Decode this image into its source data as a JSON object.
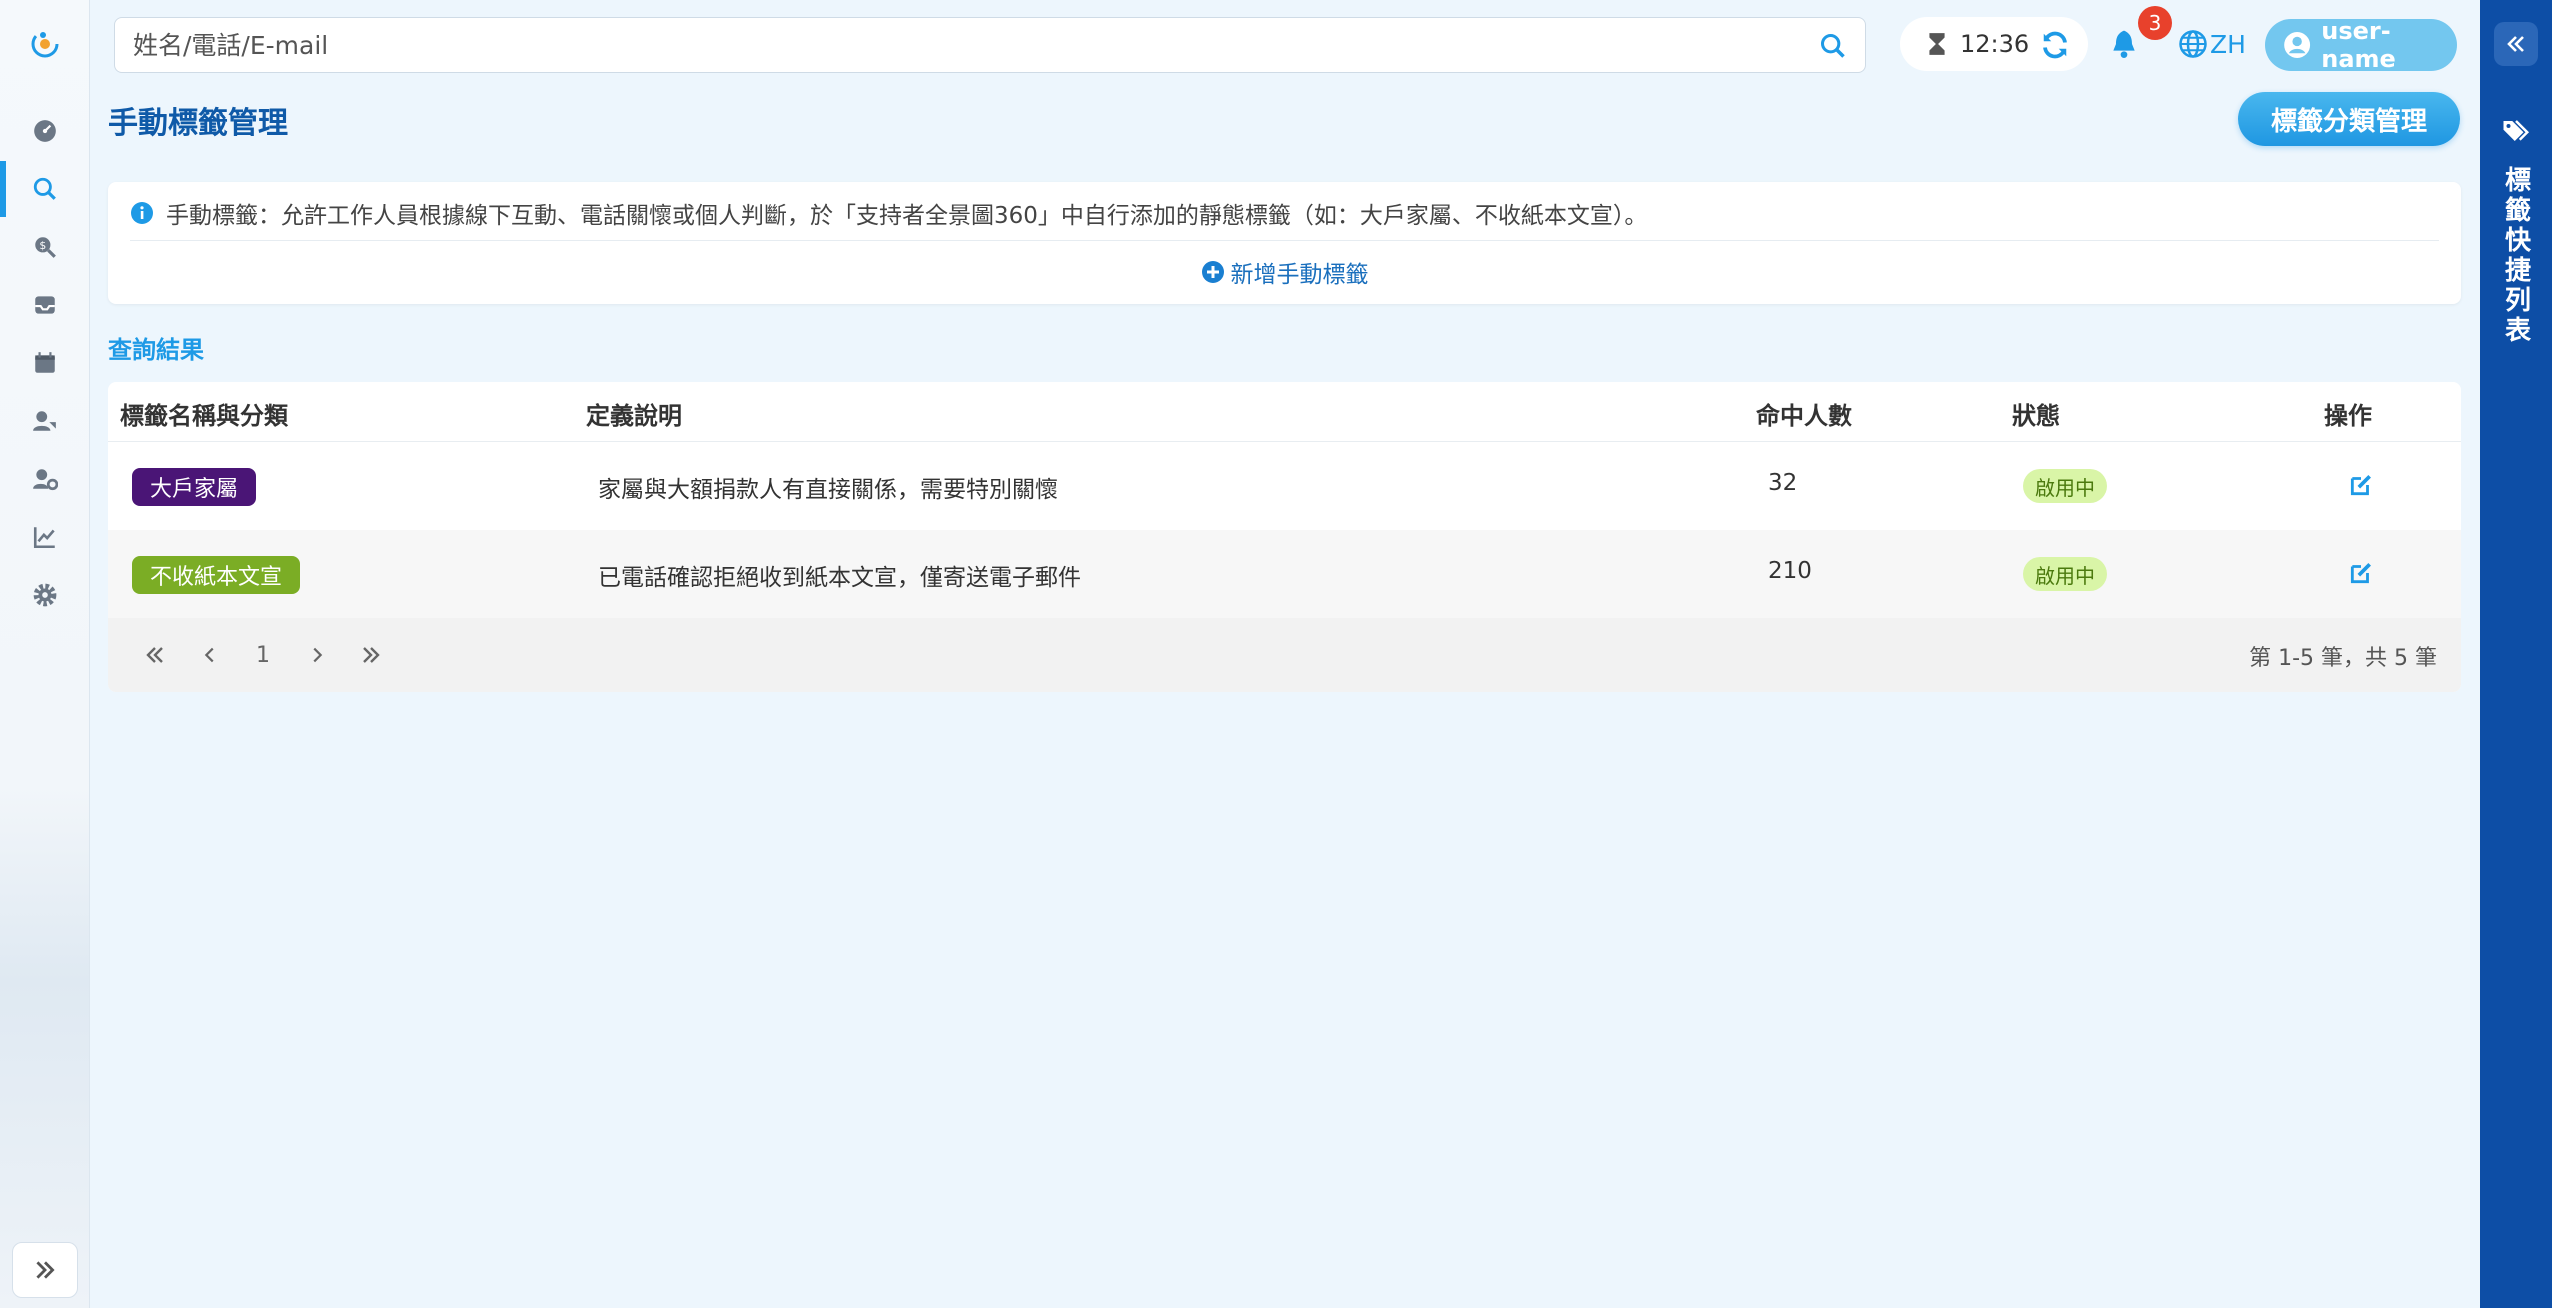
{
  "search": {
    "placeholder": "姓名/電話/E-mail"
  },
  "header": {
    "time": "12:36",
    "notification_count": "3",
    "language": "ZH",
    "user_name": "user-name"
  },
  "page": {
    "title": "手動標籤管理",
    "category_button": "標籤分類管理"
  },
  "info": {
    "text": "手動標籤：允許工作人員根據線下互動、電話關懷或個人判斷，於「支持者全景圖360」中自行添加的靜態標籤（如：大戶家屬、不收紙本文宣）。",
    "add_label": "新增手動標籤"
  },
  "results": {
    "section_title": "查詢結果",
    "columns": [
      "標籤名稱與分類",
      "定義說明",
      "命中人數",
      "狀態",
      "操作"
    ],
    "rows": [
      {
        "tag": "大戶家屬",
        "tag_color": "#4a1576",
        "description": "家屬與大額捐款人有直接關係，需要特別關懷",
        "hits": "32",
        "status": "啟用中"
      },
      {
        "tag": "不收紙本文宣",
        "tag_color": "#7bad25",
        "description": "已電話確認拒絕收到紙本文宣，僅寄送電子郵件",
        "hits": "210",
        "status": "啟用中"
      }
    ],
    "pagination": {
      "current_page": "1",
      "summary": "第 1-5 筆，共 5 筆"
    }
  },
  "right_panel": {
    "title": "標籤快捷列表"
  },
  "colors": {
    "accent": "#1e9ae6",
    "title": "#0f5aa8",
    "right_panel": "#0d4ea6",
    "status_bg": "#d9f5a7"
  }
}
